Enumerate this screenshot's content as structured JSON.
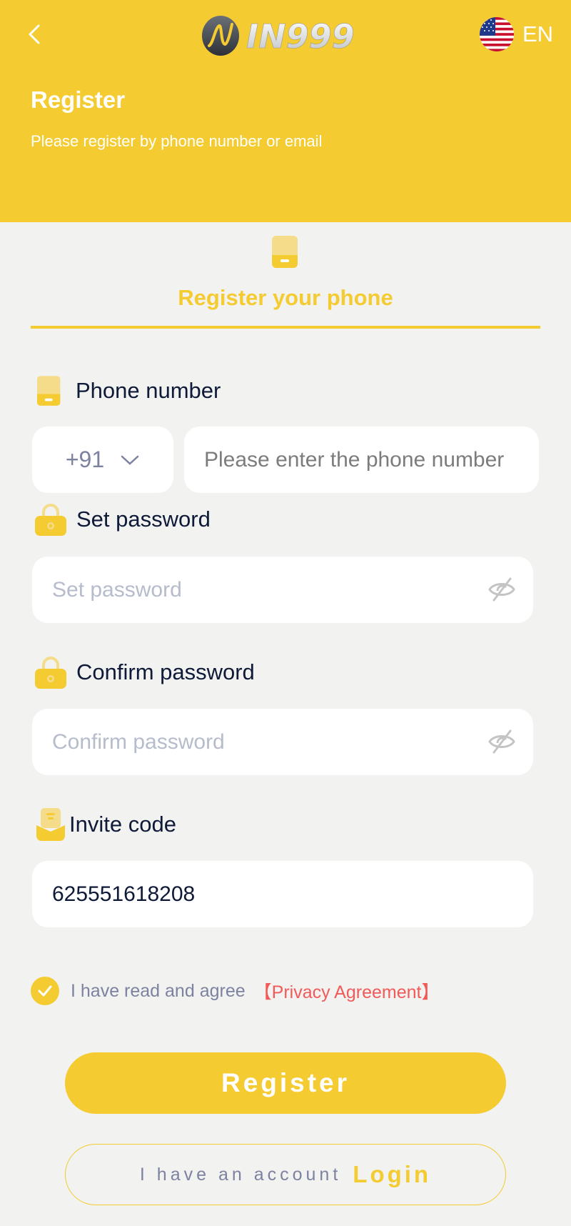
{
  "header": {
    "brand": "IN999",
    "language": "EN",
    "title": "Register",
    "subtitle": "Please register by phone number or email"
  },
  "tab": {
    "label": "Register your phone",
    "active": true
  },
  "form": {
    "phone": {
      "label": "Phone number",
      "country_code": "+91",
      "placeholder": "Please enter the phone number",
      "value": ""
    },
    "password": {
      "label": "Set password",
      "placeholder": "Set password",
      "value": ""
    },
    "confirm": {
      "label": "Confirm password",
      "placeholder": "Confirm password",
      "value": ""
    },
    "invite": {
      "label": "Invite code",
      "placeholder": "",
      "value": "625551618208"
    }
  },
  "agreement": {
    "checked": true,
    "text": "I have read and agree",
    "link": "【Privacy Agreement】"
  },
  "actions": {
    "register": "Register",
    "have_account": "I have an account",
    "login": "Login"
  },
  "colors": {
    "brand": "#f4cb30",
    "link": "#f25a5a",
    "text_dark": "#0e1a38",
    "text_muted": "#7d82a0"
  }
}
